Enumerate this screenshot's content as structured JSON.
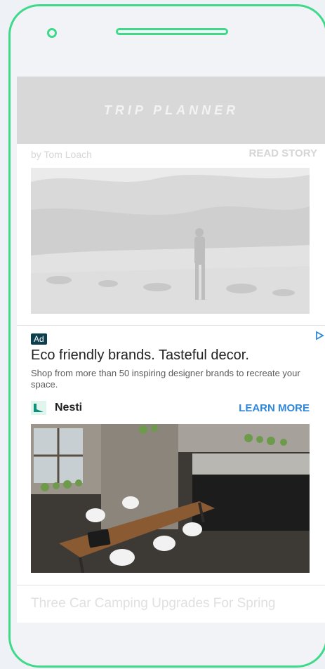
{
  "app": {
    "header_title": "TRIP PLANNER",
    "byline": "by Tom Loach",
    "read_story": "READ STORY"
  },
  "ad": {
    "badge": "Ad",
    "headline": "Eco friendly brands. Tasteful decor.",
    "body": "Shop from more than 50 inspiring designer brands to recreate your space.",
    "brand_name": "Nesti",
    "cta": "LEARN MORE"
  },
  "next_story": {
    "headline": "Three Car Camping Upgrades For Spring"
  },
  "colors": {
    "phone_outline": "#3fd98a",
    "cta": "#2f88d9",
    "ad_badge": "#0f3f4f"
  }
}
